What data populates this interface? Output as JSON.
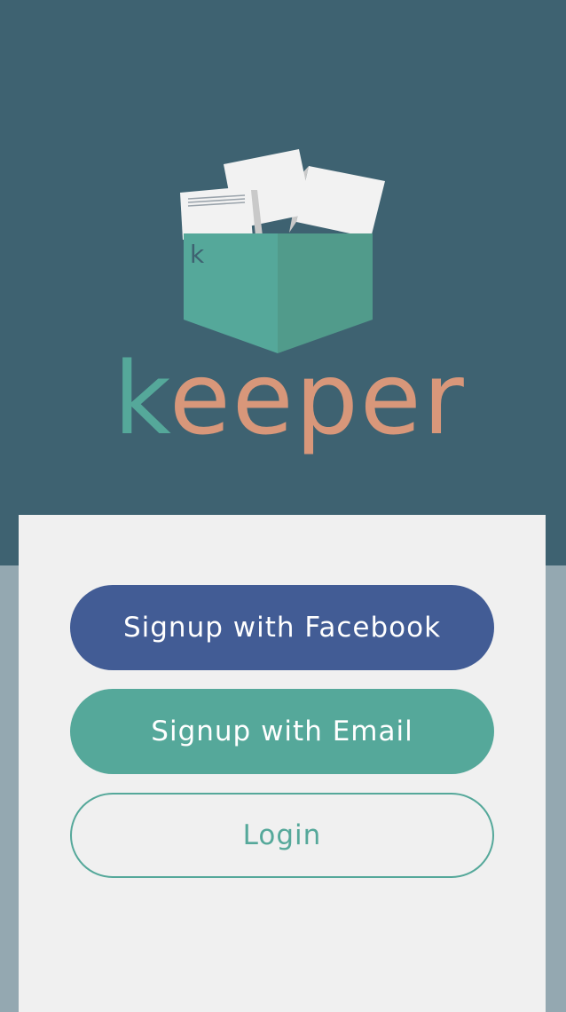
{
  "app": {
    "name_first_letter": "k",
    "name_rest": "eeper",
    "box_label": "k"
  },
  "colors": {
    "header_bg": "#3e6271",
    "footer_bg": "#94a8b1",
    "card_bg": "#f0f0f0",
    "brand_teal": "#55a89a",
    "brand_orange": "#d8977a",
    "facebook_blue": "#425c95"
  },
  "actions": {
    "facebook_label": "Signup with Facebook",
    "email_label": "Signup with Email",
    "login_label": "Login"
  },
  "icons": {
    "logo": "document-box-icon"
  }
}
